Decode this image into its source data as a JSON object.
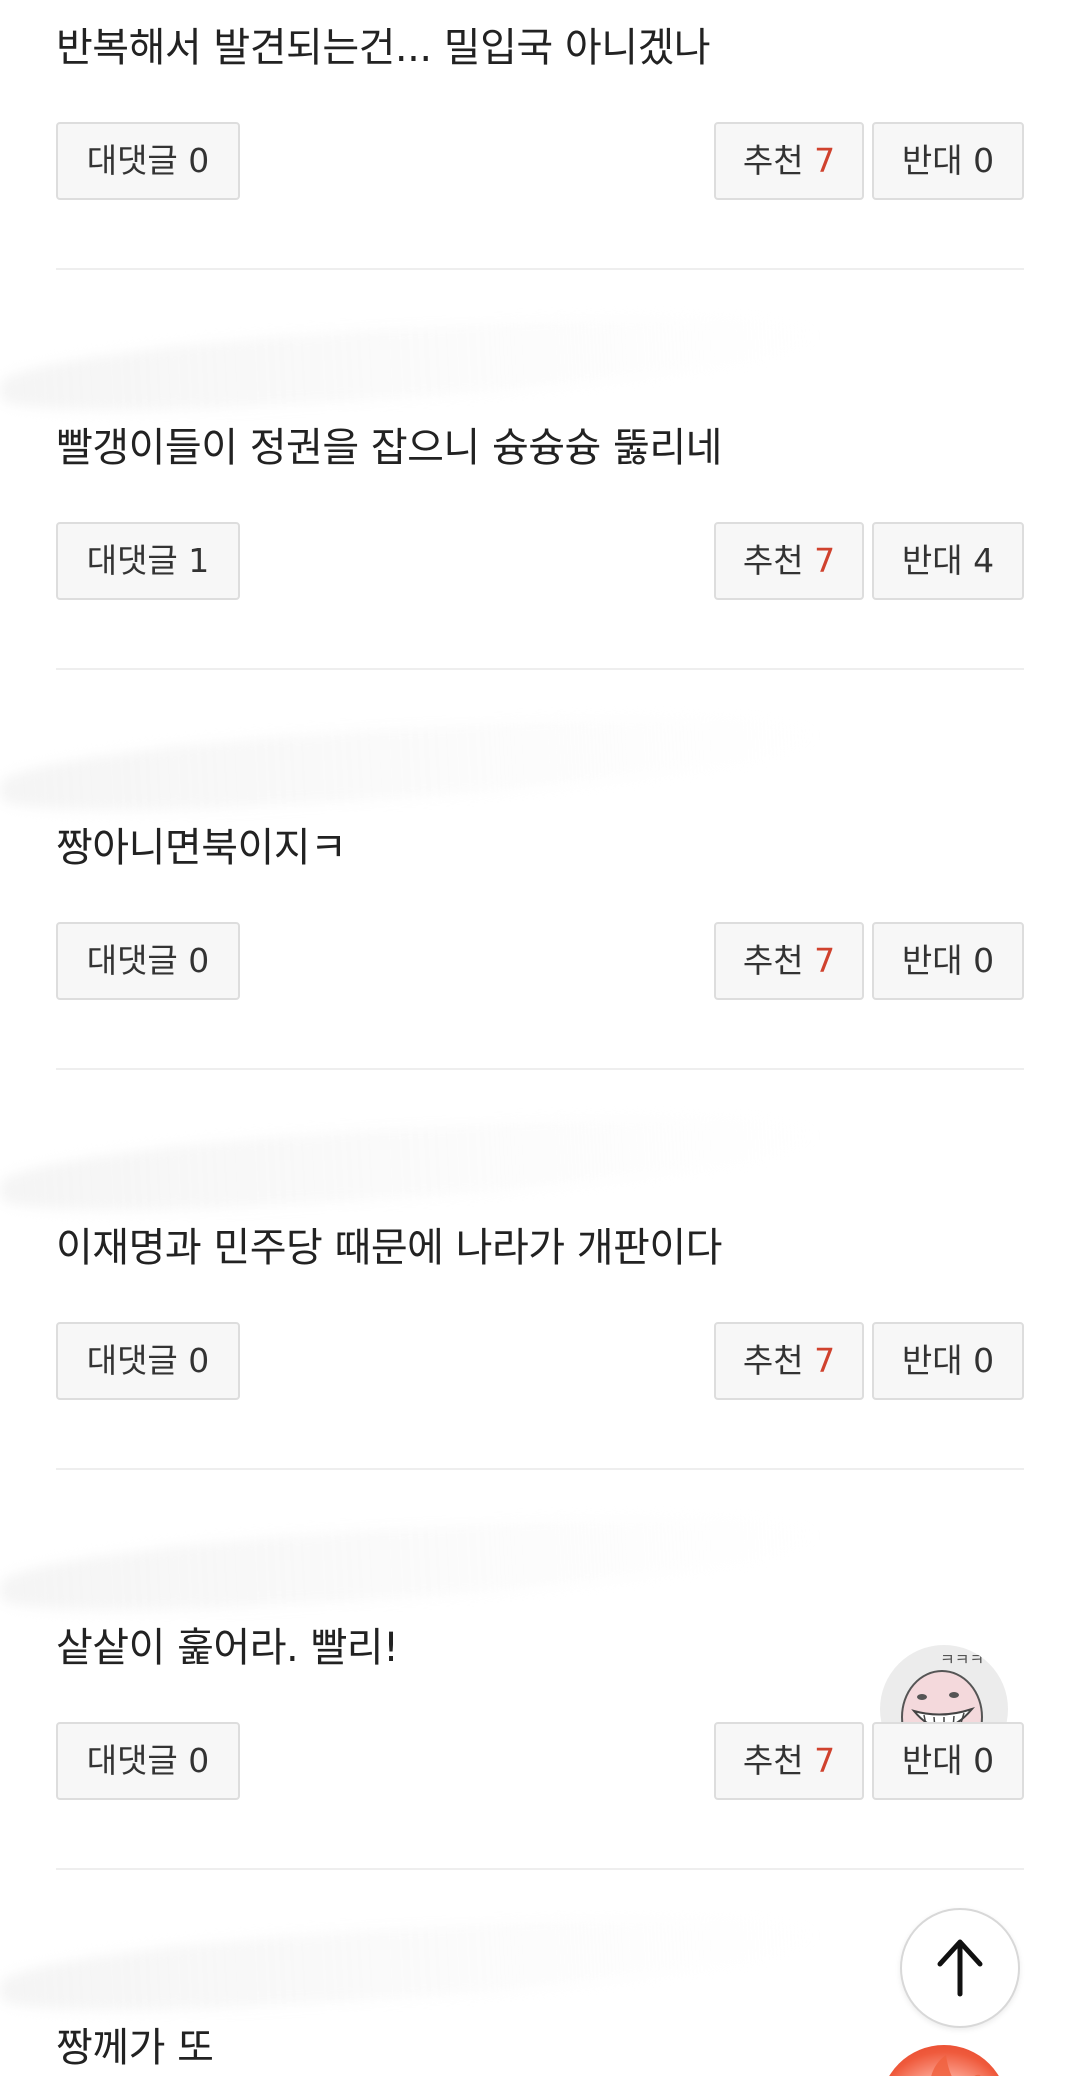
{
  "comments": [
    {
      "text": "반복해서 발견되는건... 밀입국 아니겠나",
      "reply_label": "대댓글",
      "reply_count": "0",
      "like_label": "추천",
      "like_count": "7",
      "dislike_label": "반대",
      "dislike_count": "0"
    },
    {
      "text": "빨갱이들이 정권을 잡으니 슝슝슝 뚫리네",
      "reply_label": "대댓글",
      "reply_count": "1",
      "like_label": "추천",
      "like_count": "7",
      "dislike_label": "반대",
      "dislike_count": "4"
    },
    {
      "text": "짱아니면북이지ㅋ",
      "reply_label": "대댓글",
      "reply_count": "0",
      "like_label": "추천",
      "like_count": "7",
      "dislike_label": "반대",
      "dislike_count": "0"
    },
    {
      "text": "이재명과 민주당 때문에 나라가 개판이다",
      "reply_label": "대댓글",
      "reply_count": "0",
      "like_label": "추천",
      "like_count": "7",
      "dislike_label": "반대",
      "dislike_count": "0"
    },
    {
      "text": "샅샅이 훑어라. 빨리!",
      "reply_label": "대댓글",
      "reply_count": "0",
      "like_label": "추천",
      "like_count": "7",
      "dislike_label": "반대",
      "dislike_count": "0",
      "emoticon": "laughing-pig-emoticon",
      "emoticon_caption": "ㅋㅋㅋ"
    },
    {
      "text": "짱께가 또",
      "emoticon": "angry-fire-emoticon"
    }
  ],
  "colors": {
    "accent_red": "#d0422e",
    "button_bg": "#f7f7f7",
    "button_border": "#dddddd",
    "divider": "#eeeeee"
  },
  "scroll_top": {
    "icon": "arrow-up-icon"
  }
}
